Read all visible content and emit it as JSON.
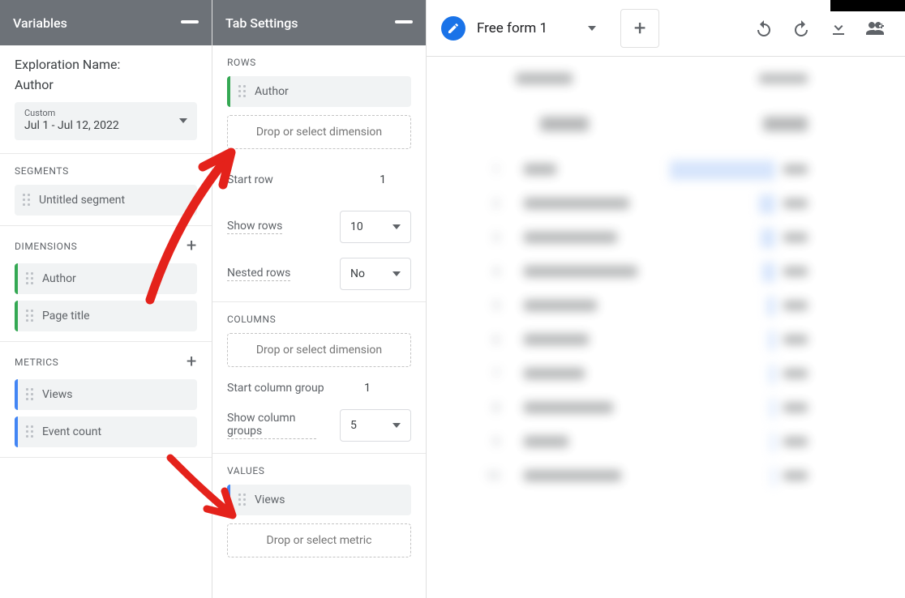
{
  "variables_panel": {
    "title": "Variables",
    "exploration_name_label": "Exploration Name:",
    "exploration_name_value": "Author",
    "date_range": {
      "custom_label": "Custom",
      "range_text": "Jul 1 - Jul 12, 2022"
    },
    "segments": {
      "heading": "SEGMENTS",
      "items": [
        "Untitled segment"
      ]
    },
    "dimensions": {
      "heading": "DIMENSIONS",
      "items": [
        "Author",
        "Page title"
      ]
    },
    "metrics": {
      "heading": "METRICS",
      "items": [
        "Views",
        "Event count"
      ]
    }
  },
  "tab_settings_panel": {
    "title": "Tab Settings",
    "rows": {
      "heading": "ROWS",
      "chip": "Author",
      "dropzone": "Drop or select dimension",
      "start_row_label": "Start row",
      "start_row_value": "1",
      "show_rows_label": "Show rows",
      "show_rows_value": "10",
      "nested_rows_label": "Nested rows",
      "nested_rows_value": "No"
    },
    "columns": {
      "heading": "COLUMNS",
      "dropzone": "Drop or select dimension",
      "start_col_label": "Start column group",
      "start_col_value": "1",
      "show_col_label": "Show column groups",
      "show_col_value": "5"
    },
    "values": {
      "heading": "VALUES",
      "chip": "Views",
      "dropzone": "Drop or select metric"
    }
  },
  "main": {
    "tab_name": "Free form 1",
    "add_tab": "+"
  }
}
